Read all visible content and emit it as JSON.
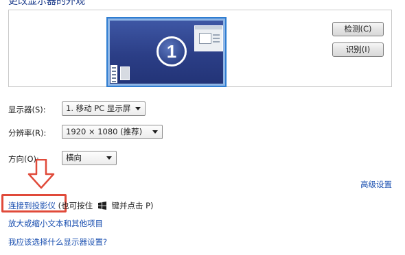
{
  "header": {
    "title": "更改显示器的外观"
  },
  "preview": {
    "monitor_number": "1"
  },
  "buttons": {
    "detect": "检测(C)",
    "identify": "识别(I)"
  },
  "fields": {
    "display": {
      "label": "显示器(S):",
      "value": "1. 移动 PC 显示屏"
    },
    "resolution": {
      "label": "分辨率(R):",
      "value": "1920 × 1080 (推荐)"
    },
    "orientation": {
      "label": "方向(O):",
      "value": "横向"
    }
  },
  "links": {
    "advanced": "高级设置",
    "connect_projector": "连接到投影仪",
    "projector_hint_prefix": "(也可按住",
    "projector_hint_suffix": "键并点击 P)",
    "zoom_text": "放大或缩小文本和其他项目",
    "which_settings": "我应该选择什么显示器设置?"
  },
  "annotation": {
    "arrow_color": "#e04a3a",
    "highlight_color": "#e04a3a"
  },
  "icons": {
    "windows_key": "windows-logo-icon",
    "down_arrow": "red-down-arrow-icon"
  }
}
